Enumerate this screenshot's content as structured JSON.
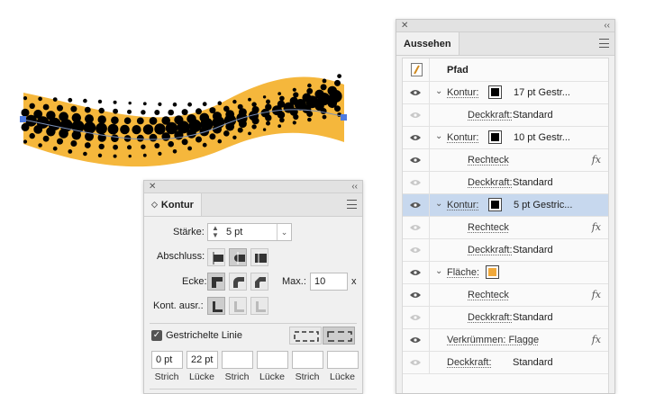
{
  "colors": {
    "art_fill": "#f5b73c",
    "dot_fill": "#000000",
    "anchor_fill": "#4e7be0",
    "selection_row": "#c7d8ee",
    "fill_swatch": "#f0a83a"
  },
  "appearance_panel": {
    "tab_label": "Aussehen",
    "object_label": "Pfad",
    "rows": [
      {
        "label": "Kontur:",
        "value": "17 pt Gestr...",
        "icon": "eye-icon",
        "swatch": "black"
      },
      {
        "label": "Deckkraft:",
        "value": "Standard",
        "icon": "eye-icon-disabled"
      },
      {
        "label": "Kontur:",
        "value": "10 pt Gestr...",
        "icon": "eye-icon",
        "swatch": "black"
      },
      {
        "label": "Rechteck",
        "icon": "eye-icon",
        "fx": "fx"
      },
      {
        "label": "Deckkraft:",
        "value": "Standard",
        "icon": "eye-icon-disabled"
      },
      {
        "label": "Kontur:",
        "value": "5 pt Gestric...",
        "icon": "eye-icon",
        "swatch": "black",
        "selected": true
      },
      {
        "label": "Rechteck",
        "icon": "eye-icon-disabled",
        "fx": "fx"
      },
      {
        "label": "Deckkraft:",
        "value": "Standard",
        "icon": "eye-icon-disabled"
      },
      {
        "label": "Fläche:",
        "icon": "eye-icon",
        "swatch": "orange"
      },
      {
        "label": "Rechteck",
        "icon": "eye-icon",
        "fx": "fx"
      },
      {
        "label": "Deckkraft:",
        "value": "Standard",
        "icon": "eye-icon-disabled"
      },
      {
        "label": "Verkrümmen: Flagge",
        "icon": "eye-icon",
        "fx": "fx"
      },
      {
        "label": "Deckkraft:",
        "value": "Standard",
        "icon": "eye-icon-disabled"
      }
    ],
    "fx_label": "fx"
  },
  "stroke_panel": {
    "tab_label": "Kontur",
    "weight_label": "Stärke:",
    "weight_value": "5 pt",
    "cap_label": "Abschluss:",
    "corner_label": "Ecke:",
    "limit_label": "Max.:",
    "limit_value": "10",
    "limit_unit": "x",
    "align_label": "Kont. ausr.:",
    "dashed_label": "Gestrichelte Linie",
    "dashed_checked": true,
    "dash_fields": [
      {
        "value": "0 pt",
        "caption": "Strich"
      },
      {
        "value": "22 pt",
        "caption": "Lücke"
      },
      {
        "value": "",
        "caption": "Strich"
      },
      {
        "value": "",
        "caption": "Lücke"
      },
      {
        "value": "",
        "caption": "Strich"
      },
      {
        "value": "",
        "caption": "Lücke"
      }
    ]
  }
}
